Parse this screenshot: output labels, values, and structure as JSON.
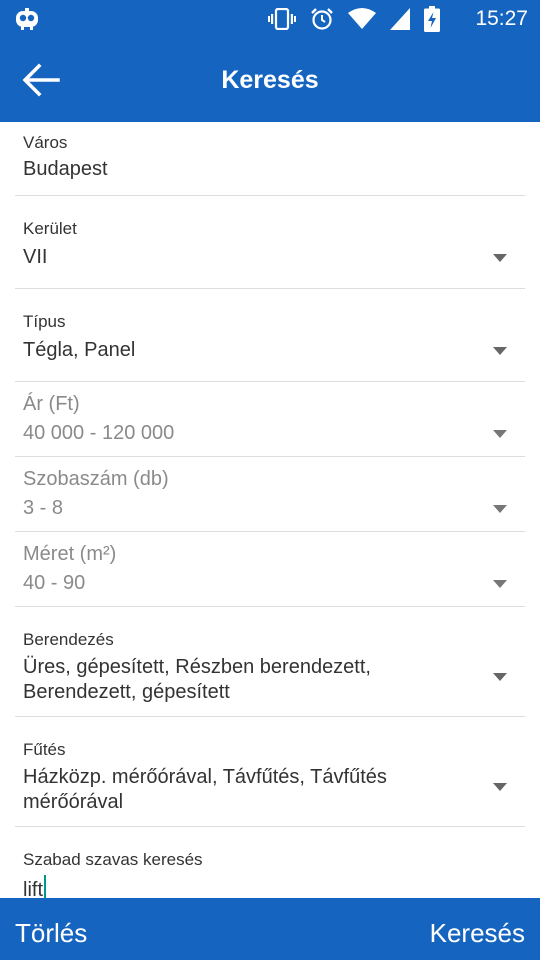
{
  "status_bar": {
    "time": "15:27",
    "icons": [
      "robot-icon",
      "vibrate-icon",
      "alarm-icon",
      "wifi-icon",
      "signal-icon",
      "battery-charging-icon"
    ]
  },
  "app_bar": {
    "title": "Keresés",
    "back_icon": "arrow-back-icon"
  },
  "form": {
    "city": {
      "label": "Város",
      "value": "Budapest"
    },
    "district": {
      "label": "Kerület",
      "value": "VII"
    },
    "type": {
      "label": "Típus",
      "value": "Tégla, Panel"
    },
    "price": {
      "label": "Ár (Ft)",
      "value": "40 000 - 120 000"
    },
    "rooms": {
      "label": "Szobaszám (db)",
      "value": "3 - 8"
    },
    "size": {
      "label": "Méret (m²)",
      "value": "40 - 90"
    },
    "furnishing": {
      "label": "Berendezés",
      "value_line1": "Üres, gépesített, Részben berendezett,",
      "value_line2": "Berendezett, gépesített"
    },
    "heating": {
      "label": "Fűtés",
      "value_line1": "Házközp. mérőórával, Távfűtés, Távfűtés",
      "value_line2": "mérőórával"
    },
    "keyword": {
      "label": "Szabad szavas keresés",
      "value": "lift"
    }
  },
  "bottom_bar": {
    "clear_label": "Törlés",
    "search_label": "Keresés"
  },
  "colors": {
    "primary": "#1565c0",
    "cursor": "#009688",
    "divider": "#dddddd",
    "disabled_text": "#8a8a8a"
  }
}
